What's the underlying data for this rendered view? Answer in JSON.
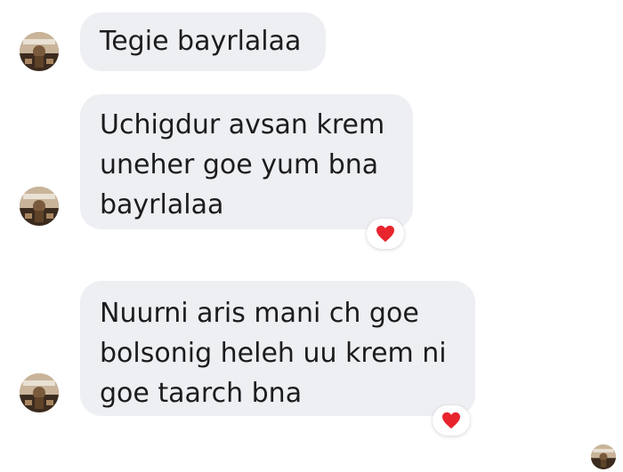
{
  "messages": [
    {
      "text": "Tegie bayrlalaa",
      "reaction": null
    },
    {
      "text": "Uchigdur avsan krem\nuneher goe yum bna\nbayrlalaa",
      "reaction": "heart-icon"
    },
    {
      "text": "Nuurni aris mani ch goe\nbolsonig heleh uu krem ni\ngoe taarch bna",
      "reaction": "heart-icon"
    }
  ],
  "colors": {
    "bubble_bg": "#eeeff3",
    "text": "#1c1c1e",
    "heart": "#e8242c"
  }
}
